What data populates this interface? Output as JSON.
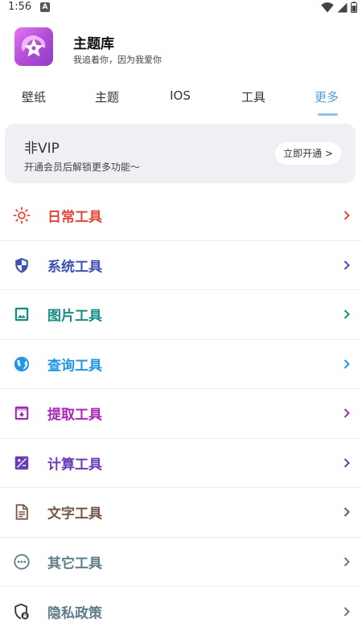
{
  "status_bar": {
    "time": "1:56",
    "notification_badge": "A"
  },
  "app": {
    "title": "主题库",
    "subtitle": "我追着你，因为我爱你"
  },
  "tabs": [
    {
      "label": "壁纸",
      "active": false
    },
    {
      "label": "主题",
      "active": false
    },
    {
      "label": "IOS",
      "active": false
    },
    {
      "label": "工具",
      "active": false
    },
    {
      "label": "更多",
      "active": true
    }
  ],
  "vip": {
    "title": "非VIP",
    "description": "开通会员后解锁更多功能～",
    "button_label": "立即开通 >"
  },
  "menu": [
    {
      "label": "日常工具",
      "icon": "sun-icon",
      "color": "#e2483c"
    },
    {
      "label": "系统工具",
      "icon": "shield-icon",
      "color": "#3f51b5"
    },
    {
      "label": "图片工具",
      "icon": "image-icon",
      "color": "#168f86"
    },
    {
      "label": "查询工具",
      "icon": "globe-icon",
      "color": "#2196e6"
    },
    {
      "label": "提取工具",
      "icon": "archive-icon",
      "color": "#a726b8"
    },
    {
      "label": "计算工具",
      "icon": "calculator-icon",
      "color": "#6a3bb8"
    },
    {
      "label": "文字工具",
      "icon": "document-icon",
      "color": "#795548"
    },
    {
      "label": "其它工具",
      "icon": "more-icon",
      "color": "#607d8b"
    },
    {
      "label": "隐私政策",
      "icon": "privacy-icon",
      "color": "#607d8b"
    }
  ]
}
